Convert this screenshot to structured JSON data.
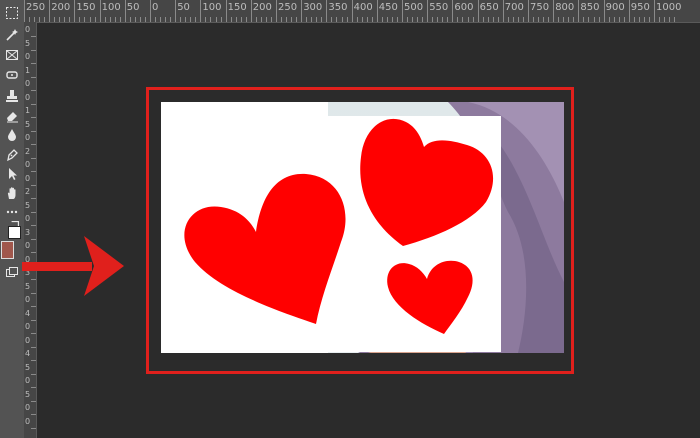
{
  "ruler": {
    "top_labels": [
      "250",
      "200",
      "150",
      "100",
      "50",
      "0",
      "50",
      "100",
      "150",
      "200",
      "250",
      "300",
      "350",
      "400",
      "450",
      "500",
      "550",
      "600",
      "650",
      "700",
      "750",
      "800",
      "850",
      "900",
      "950",
      "1000"
    ],
    "left_labels": [
      "0",
      "5",
      "0",
      "1",
      "0",
      "0",
      "1",
      "5",
      "0",
      "2",
      "0",
      "0",
      "2",
      "5",
      "0",
      "3",
      "0",
      "0",
      "3",
      "5",
      "0",
      "4",
      "0",
      "0",
      "4",
      "5",
      "0",
      "5",
      "0",
      "0"
    ]
  },
  "tools": [
    {
      "icon": "marquee-icon"
    },
    {
      "icon": "magic-wand-icon"
    },
    {
      "icon": "frame-icon"
    },
    {
      "icon": "healing-brush-icon"
    },
    {
      "icon": "stamp-icon"
    },
    {
      "icon": "eraser-icon"
    },
    {
      "icon": "blur-drop-icon"
    },
    {
      "icon": "pen-icon"
    },
    {
      "icon": "path-selection-icon"
    },
    {
      "icon": "hand-icon"
    },
    {
      "icon": "more-tools-icon"
    }
  ],
  "colors": {
    "foreground": "#a0574c",
    "background": "#ffffff",
    "heart": "#ff0000",
    "highlight": "#e0201c",
    "hair": "#8d7a9e"
  },
  "canvas": {
    "layers": [
      "white-layer",
      "photo-layer",
      "heart-large",
      "heart-top-right",
      "heart-small"
    ]
  }
}
